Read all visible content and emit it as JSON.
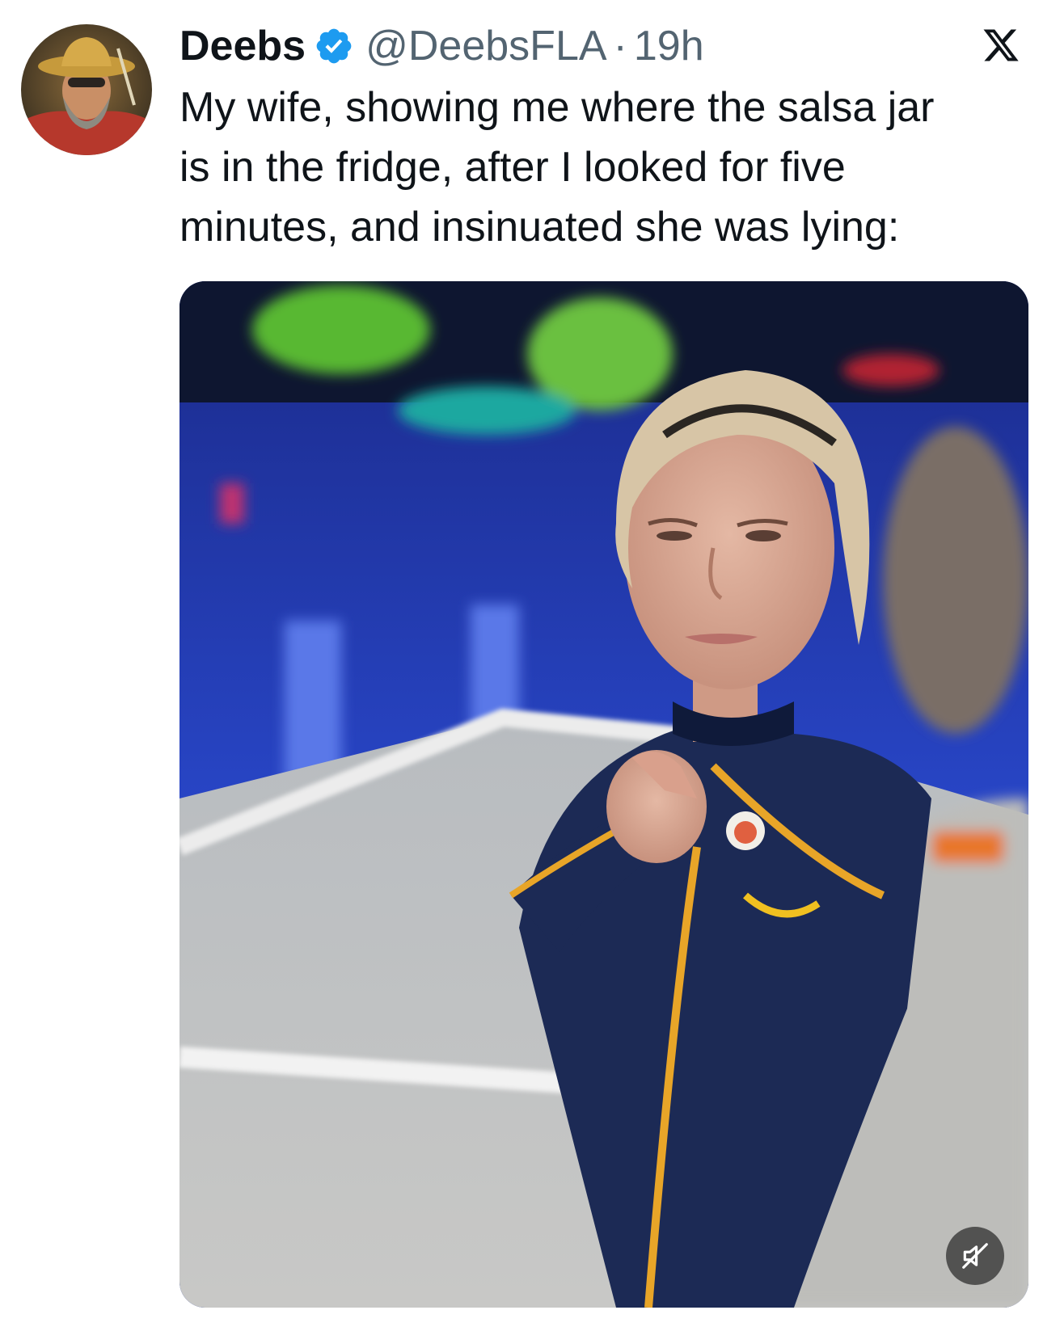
{
  "author": {
    "display_name": "Deebs",
    "handle": "@DeebsFLA",
    "separator": "·",
    "timestamp": "19h",
    "verified": true,
    "verified_color": "#1d9bf0"
  },
  "tweet": {
    "text": "My wife, showing me where the salsa jar\nis in the fridge, after I looked for five\nminutes, and insinuated she was lying:"
  },
  "media": {
    "type": "video",
    "muted": true
  },
  "icons": {
    "platform_logo": "x-logo-icon",
    "verified_badge": "verified-badge-icon",
    "mute": "muted-speaker-icon"
  },
  "colors": {
    "text_primary": "#0f1419",
    "text_secondary": "#536471",
    "accent": "#1d9bf0"
  }
}
